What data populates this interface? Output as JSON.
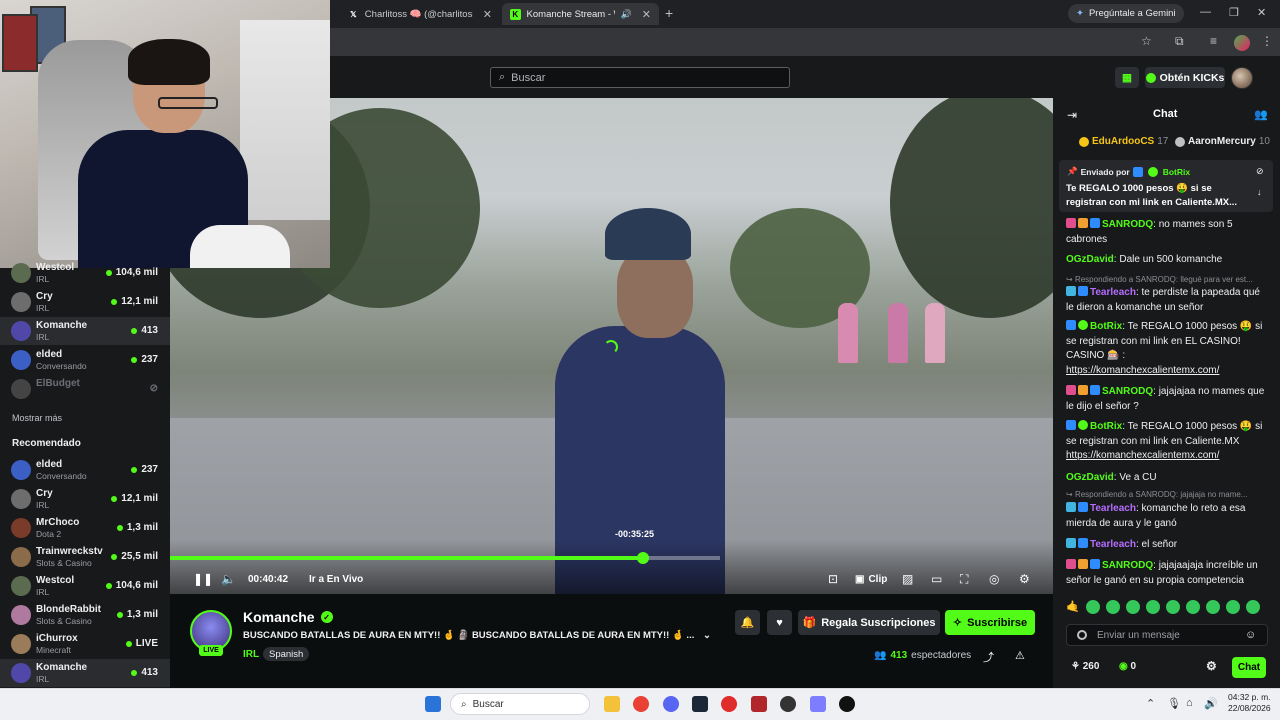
{
  "browser": {
    "tabs": [
      {
        "title": "Charlitoss 🧠 (@charlitoss_) / X",
        "favicon": "x-icon"
      },
      {
        "title": "Komanche Stream - Watch",
        "favicon": "kick-icon"
      }
    ],
    "gemini_label": "Pregúntale a Gemini"
  },
  "kick": {
    "search_placeholder": "Buscar",
    "get_kicks_label": "Obtén KICKs"
  },
  "sidebar": {
    "following": [
      {
        "name": "Westcol",
        "sub": "IRL",
        "count": "104,6 mil",
        "color": "#5a6b4f"
      },
      {
        "name": "Cry",
        "sub": "IRL",
        "count": "12,1 mil",
        "color": "#6d6d6d"
      },
      {
        "name": "Komanche",
        "sub": "IRL",
        "count": "413",
        "color": "#5048a8"
      },
      {
        "name": "elded",
        "sub": "Conversando",
        "count": "237",
        "color": "#3b5fc4"
      },
      {
        "name": "ElBudget",
        "sub": "",
        "count": "",
        "color": "#444"
      }
    ],
    "show_more": "Mostrar más",
    "recommended_title": "Recomendado",
    "recommended": [
      {
        "name": "elded",
        "sub": "Conversando",
        "count": "237",
        "color": "#3b5fc4"
      },
      {
        "name": "Cry",
        "sub": "IRL",
        "count": "12,1 mil",
        "color": "#6d6d6d"
      },
      {
        "name": "MrChoco",
        "sub": "Dota 2",
        "count": "1,3 mil",
        "color": "#7a3b2a"
      },
      {
        "name": "Trainwreckstv",
        "sub": "Slots & Casino",
        "count": "25,5 mil",
        "color": "#8a6b4a"
      },
      {
        "name": "Westcol",
        "sub": "IRL",
        "count": "104,6 mil",
        "color": "#5a6b4f"
      },
      {
        "name": "BlondeRabbit",
        "sub": "Slots & Casino",
        "count": "1,3 mil",
        "color": "#b07aa0"
      },
      {
        "name": "iChurrox",
        "sub": "Minecraft",
        "count": "LIVE",
        "color": "#9a7b5a"
      },
      {
        "name": "Komanche",
        "sub": "IRL",
        "count": "413",
        "color": "#5048a8"
      }
    ]
  },
  "player": {
    "elapsed": "00:40:42",
    "go_live": "Ir a En Vivo",
    "seek_tooltip": "-00:35:25",
    "progress_fraction": 0.86,
    "clip_label": "Clip"
  },
  "stream": {
    "channel": "Komanche",
    "live_badge": "LIVE",
    "title": "BUSCANDO BATALLAS DE AURA EN MTY!! 🤞 🗿 BUSCANDO BATALLAS DE AURA EN MTY!! 🤞 ...",
    "category": "IRL",
    "language_tag": "Spanish",
    "gift_label": "Regala Suscripciones",
    "subscribe_label": "Suscribirse",
    "viewers_count": "413",
    "viewers_label": "espectadores"
  },
  "chat": {
    "title": "Chat",
    "leaderboard": [
      {
        "name": "EduArdooCS",
        "points": "17",
        "color": "#f5c518"
      },
      {
        "name": "AaronMercury",
        "points": "10",
        "color": "#c0c0c0"
      }
    ],
    "pinned": {
      "by_label": "Enviado por",
      "by_user": "BotRix",
      "text": "Te REGALO 1000 pesos 🤑 si se registran con mi link en Caliente.MX..."
    },
    "messages": [
      {
        "user": "SANRODQ",
        "color": "#53fc18",
        "text": "no mames son 5 cabrones"
      },
      {
        "user": "OGzDavid",
        "color": "#53fc18",
        "text": "Dale un 500 komanche"
      },
      {
        "reply": "Respondiendo a SANRODQ: llegué para ver est..."
      },
      {
        "user": "Tearleach",
        "color": "#b66dff",
        "text": "te perdiste la papeada qué le dieron a komanche un señor"
      },
      {
        "user": "BotRix",
        "color": "#53fc18",
        "text": "Te REGALO 1000 pesos 🤑 si se registran con mi link en EL CASINO! CASINO 🎰 :",
        "link": "https://komanchexcalientemx.com/"
      },
      {
        "user": "SANRODQ",
        "color": "#53fc18",
        "text": "jajajajaa no mames que le dijo el señor ?"
      },
      {
        "user": "BotRix",
        "color": "#53fc18",
        "text": "Te REGALO 1000 pesos 🤑 si se registran con mi link en Caliente.MX",
        "link": "https://komanchexcalientemx.com/"
      },
      {
        "user": "OGzDavid",
        "color": "#53fc18",
        "text": "Ve a CU"
      },
      {
        "reply": "Respondiendo a SANRODQ: jajajaja no mame..."
      },
      {
        "user": "Tearleach",
        "color": "#b66dff",
        "text": "komanche lo reto a esa mierda de aura y le ganó"
      },
      {
        "user": "Tearleach",
        "color": "#b66dff",
        "text": "el señor"
      },
      {
        "user": "SANRODQ",
        "color": "#53fc18",
        "text": "jajajaajaja increíble un señor le ganó en su propia competencia"
      }
    ],
    "input_placeholder": "Enviar un mensaje",
    "footer_followers": "260",
    "footer_kicks": "0",
    "chat_button": "Chat"
  },
  "taskbar": {
    "search_placeholder": "Buscar",
    "time": "04:32 p. m.",
    "date": "22/08/2026"
  },
  "colors": {
    "kick_green": "#53fc18",
    "bg": "#0b0e0f",
    "panel": "#18191b"
  }
}
